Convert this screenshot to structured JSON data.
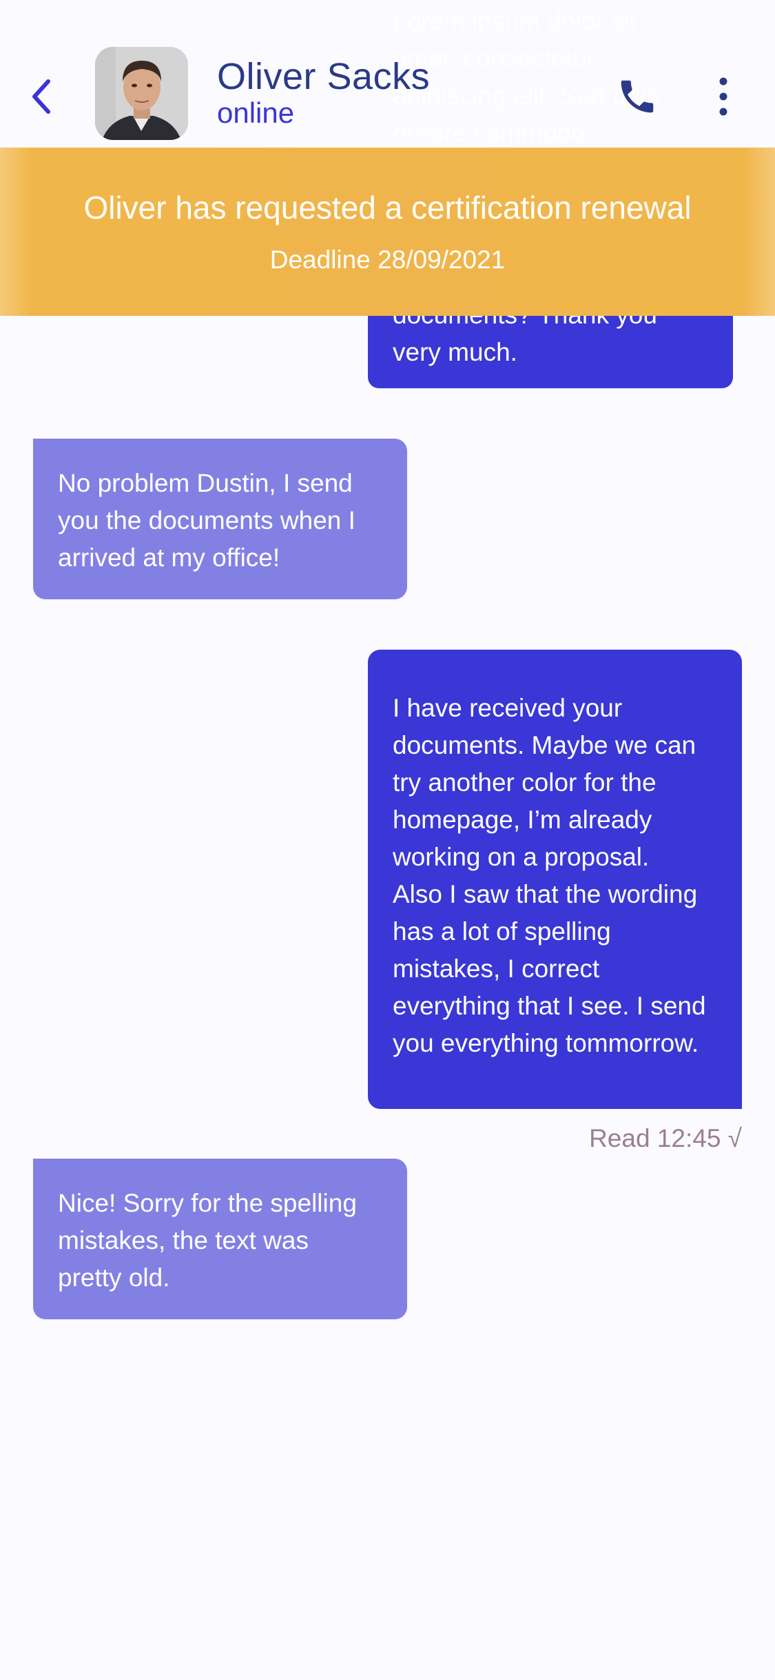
{
  "header": {
    "contact_name": "Oliver Sacks",
    "contact_status": "online",
    "overlay_text": "Lorem ipsum dolor sit amet, consectetur adipiscing elit. Sed quis ornare commodo",
    "back_icon": "chevron-left-icon",
    "call_icon": "phone-icon",
    "menu_icon": "more-vertical-icon"
  },
  "banner": {
    "title": "Oliver has requested a certification renewal",
    "subtitle": "Deadline 28/09/2021"
  },
  "messages": [
    {
      "direction": "sent",
      "text": "documents? Thank you\nvery much."
    },
    {
      "direction": "received",
      "text": "No problem Dustin, I send\nyou the documents when I\narrived at my office!"
    },
    {
      "direction": "sent",
      "text": "I have received your\ndocuments. Maybe we can\ntry another color for the\nhomepage, I’m already\nworking on a proposal.\nAlso I saw that the wording\nhas a lot of spelling\nmistakes, I correct\neverything that I see. I send\nyou everything tommorrow."
    },
    {
      "direction": "received",
      "text": "Nice! Sorry for the spelling\nmistakes, the text was\npretty old."
    }
  ],
  "read_receipt": "Read 12:45 √",
  "colors": {
    "accent": "#3a37d6",
    "received_bubble": "#8380e4",
    "banner": "#efb54c",
    "name_text": "#2b3a86",
    "background": "#fbfaff"
  }
}
